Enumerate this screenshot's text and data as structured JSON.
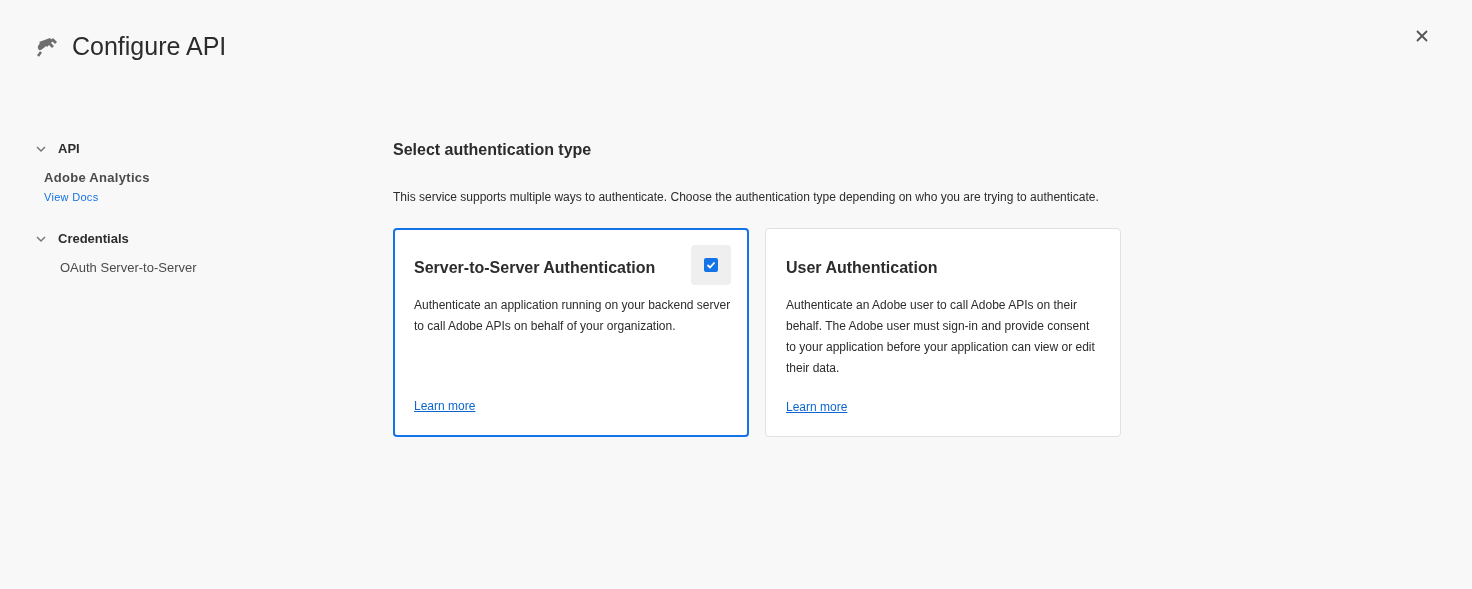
{
  "header": {
    "title": "Configure API"
  },
  "sidebar": {
    "sections": [
      {
        "label": "API",
        "expanded": true,
        "items": [
          {
            "kind": "name",
            "label": "Adobe Analytics",
            "link": "View Docs"
          }
        ]
      },
      {
        "label": "Credentials",
        "expanded": true,
        "items": [
          {
            "kind": "plain",
            "label": "OAuth Server-to-Server"
          }
        ]
      }
    ]
  },
  "main": {
    "heading": "Select authentication type",
    "description": "This service supports multiple ways to authenticate. Choose the authentication type depending on who you are trying to authenticate.",
    "cards": [
      {
        "title": "Server-to-Server Authentication",
        "body": "Authenticate an application running on your backend server to call Adobe APIs on behalf of your organization.",
        "link": "Learn more",
        "selected": true
      },
      {
        "title": "User Authentication",
        "body": "Authenticate an Adobe user to call Adobe APIs on their behalf. The Adobe user must sign-in and provide consent to your application before your application can view or edit their data.",
        "link": "Learn more",
        "selected": false
      }
    ]
  }
}
